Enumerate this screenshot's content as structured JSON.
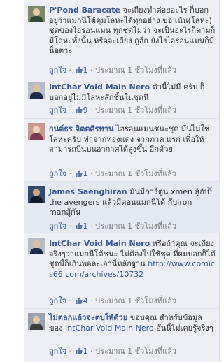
{
  "colors": {
    "link": "#3b5998",
    "background": "#edeff4",
    "meta": "#808080"
  },
  "comments": [
    {
      "author": "P'Pond Baracate",
      "body": "จะเถียงทำต่อยอะไร ก็บอกอยู่ว่าแมกนีโต้คุมโลหะได้ทุกอย่าง ขอ เน้น(โลหะ) ชุดของไอรอนแมน ทุกชุดไม่ว่า จะเป็นอะไรก็ตามก็มีโลหะทั้งนั้น หรือจะเถียง กูอีก ยังไงไอร่อนแมนก็มีน็อตาะ",
      "like_label": "ถูกใจ",
      "like_count": "1",
      "time": "ประมาณ 1 ชั่วโมงที่แล้ว"
    },
    {
      "author": "IntChar Void Main Nero",
      "body": "ตัวนี้ไม่มี ครับ ก็บอกอยู่ไม่มีโลหะสักชิ้นในชุดนี",
      "like_label": "ถูกใจ",
      "like_count": "9",
      "time": "ประมาณ 1 ชั่วโมงที่แล้ว"
    },
    {
      "author": "กนต์ธร จิตตศีรทาน",
      "body": "ไอรอนแมนชนะชุด มันไม่ใช่โลหะครับ ทำจากทองแดง จากภาค แรก เพื่อให้สามารถบินบนอากาศได้สูงขึ้น อีกด้วย",
      "like_label": "ถูกใจ",
      "like_count": "1",
      "time": "ประมาณ 1 ชั่วโมงที่แล้ว"
    },
    {
      "author": "James Saenghiran",
      "body": "มันมีการ์ตูน xmen สู้กับ the avengers แล้วมีตอนแมกนีโต้ กับiron manสู้กัน",
      "like_label": "ถูกใจ",
      "like_count": "1",
      "time": "ประมาณ 1 ชั่วโมงที่แล้ว"
    },
    {
      "author": "IntChar Void Main Nero",
      "body_before": "หรือถ้าคุณ จะเถียงจริงๆว่าแมกนีโต้ชนะ ไม่ต้องไปใช้ชุด ที่ผมบอกก็ได้ ชุดนี้ก็เกินพอละเอานี้หลักฐาน",
      "url": "http://www.comics66.com/archives/10732",
      "like_label": "ถูกใจ",
      "like_count": "4",
      "time": "ประมาณ 1 ชั่วโมงที่แล้ว"
    },
    {
      "author": "ไม่ตลกแล้วจะตบให้ด้วย",
      "body_before": "ขอบคุณ สำหรับข้อมูลของ",
      "mention": "IntChar Void Main Nero",
      "body_after": "อันนี้ไม่เคยรู้จริงๆ",
      "like_label": "ถูกใจ",
      "like_count": "1",
      "time": "ประมาณ 1 ชั่วโมงที่แล้ว"
    }
  ]
}
